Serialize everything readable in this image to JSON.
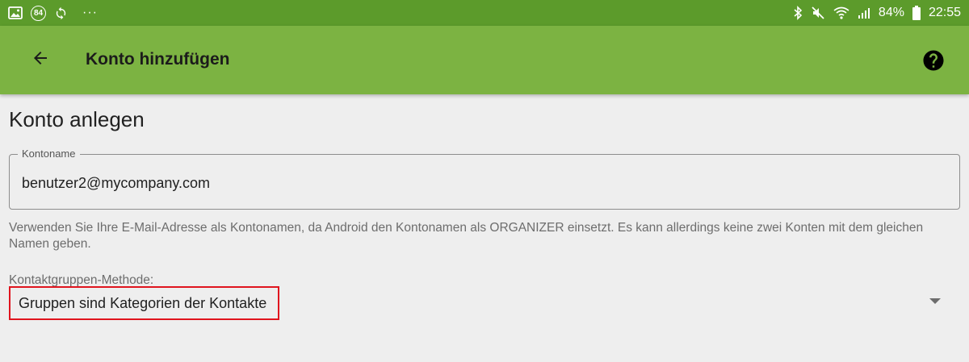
{
  "status_bar": {
    "notification_badge": "84",
    "more_indicator": "···",
    "battery_percent": "84%",
    "time": "22:55"
  },
  "app_bar": {
    "title": "Konto hinzufügen",
    "back_icon": "arrow-back-icon",
    "help_icon": "help-circle-icon"
  },
  "form": {
    "section_title": "Konto anlegen",
    "account_name": {
      "label": "Kontoname",
      "value": "benutzer2@mycompany.com"
    },
    "help_text": "Verwenden Sie Ihre E-Mail-Adresse als Kontonamen, da Android den Kontonamen als ORGANIZER einsetzt. Es kann allerdings keine zwei Konten mit dem gleichen Namen geben.",
    "contact_group_method": {
      "label": "Kontaktgruppen-Methode:",
      "selected": "Gruppen sind Kategorien der Kontakte"
    }
  },
  "colors": {
    "status_bar": "#5c9b2b",
    "app_bar": "#7cb342",
    "background": "#eeeeee",
    "highlight_border": "#e0141e"
  }
}
